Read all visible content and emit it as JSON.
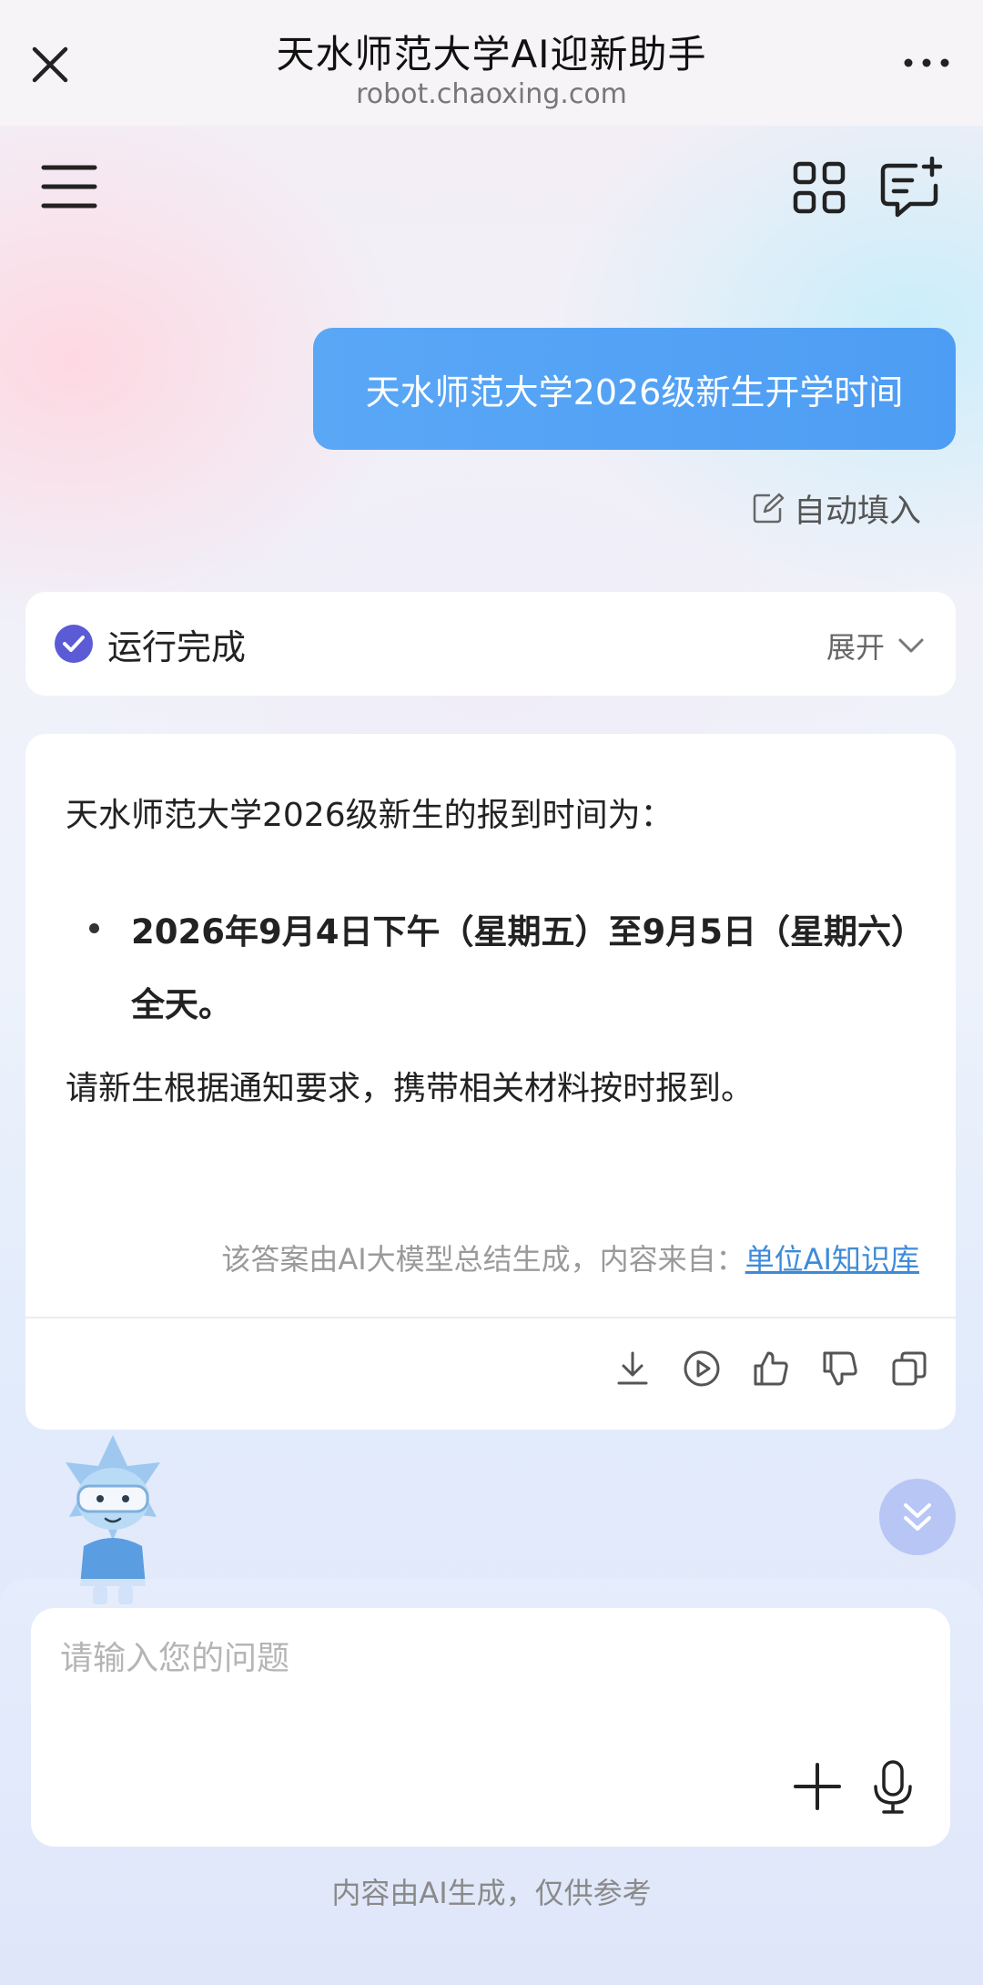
{
  "header": {
    "title": "天水师范大学AI迎新助手",
    "url": "robot.chaoxing.com"
  },
  "conversation": {
    "user_message": "天水师范大学2026级新生开学时间",
    "autofill_label": "自动填入",
    "status": {
      "label": "运行完成",
      "expand_label": "展开"
    },
    "answer": {
      "intro": "天水师范大学2026级新生的报到时间为：",
      "bullet": "2026年9月4日下午（星期五）至9月5日（星期六）全天。",
      "note": "请新生根据通知要求，携带相关材料按时报到。",
      "source_prefix": "该答案由AI大模型总结生成，内容来自：",
      "source_link": "单位AI知识库"
    }
  },
  "input": {
    "placeholder": "请输入您的问题",
    "disclaimer": "内容由AI生成，仅供参考"
  },
  "colors": {
    "user_bubble": "#4d9df4",
    "status_check": "#5b5bd6",
    "link": "#3d8bd8",
    "scroll_button": "#b7c6f4"
  },
  "icons": [
    "close-icon",
    "more-icon",
    "menu-icon",
    "grid-icon",
    "new-chat-icon",
    "edit-icon",
    "check-circle-icon",
    "chevron-down-icon",
    "download-icon",
    "play-icon",
    "thumbs-up-icon",
    "thumbs-down-icon",
    "copy-icon",
    "double-chevron-down-icon",
    "plus-icon",
    "microphone-icon"
  ]
}
